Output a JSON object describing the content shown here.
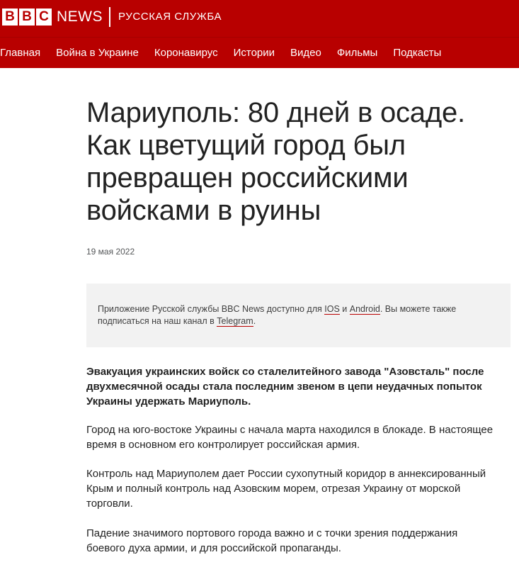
{
  "header": {
    "logo_letters": [
      "B",
      "B",
      "C"
    ],
    "news_label": "NEWS",
    "service_label": "РУССКАЯ СЛУЖБА",
    "brand_color": "#b80000"
  },
  "nav": {
    "items": [
      "Главная",
      "Война в Украине",
      "Коронавирус",
      "Истории",
      "Видео",
      "Фильмы",
      "Подкасты"
    ]
  },
  "article": {
    "title": "Мариуполь: 80 дней в осаде. Как цветущий город был превращен российскими войсками в руины",
    "date": "19 мая 2022",
    "app_promo": {
      "text_1": "Приложение Русской службы BBC News доступно для ",
      "link_ios": "IOS",
      "text_2": " и ",
      "link_android": "Android",
      "text_3": ". Вы можете также подписаться на наш канал в ",
      "link_telegram": "Telegram",
      "text_4": "."
    },
    "paragraphs": [
      "Эвакуация украинских войск со сталелитейного завода \"Азовсталь\" после двухмесячной осады стала последним звеном в цепи неудачных попыток Украины удержать Мариуполь.",
      "Город на юго-востоке Украины с начала марта находился в блокаде. В настоящее время в основном его контролирует российская армия.",
      "Контроль над Мариуполем дает России сухопутный коридор в аннексированный Крым и полный контроль над Азовским морем, отрезая Украину от морской торговли.",
      "Падение значимого портового города важно и с точки зрения поддержания боевого духа армии, и для российской пропаганды."
    ]
  }
}
